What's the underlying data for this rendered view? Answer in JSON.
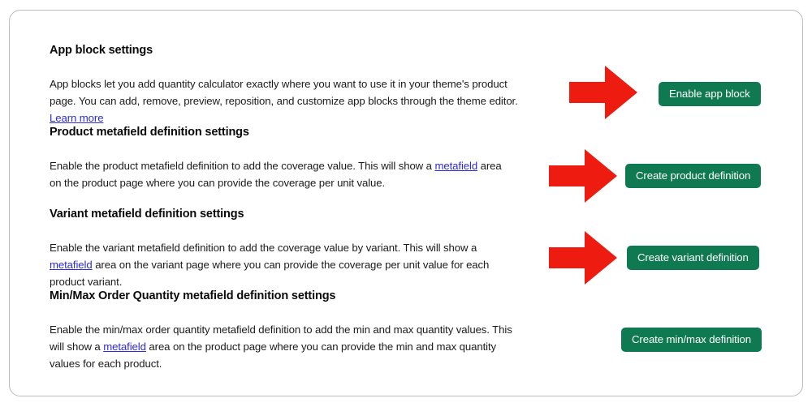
{
  "card": {
    "sections": [
      {
        "id": "app-block",
        "title": "App block settings",
        "body_pre": "App blocks let you add quantity calculator exactly where you want to use it in your theme's product page. You can add, remove, preview, reposition, and customize app blocks through the theme editor. ",
        "link_text": "Learn more",
        "body_post": "",
        "button_label": "Enable app block",
        "has_arrow": true,
        "arrow_name": "red-arrow-right-icon"
      },
      {
        "id": "product-metafield",
        "title": "Product metafield definition settings",
        "body_pre": "Enable the product metafield definition to add the coverage value. This will show a ",
        "link_text": "metafield",
        "body_post": " area on the product page where you can provide the coverage per unit value.",
        "button_label": "Create product definition",
        "has_arrow": true,
        "arrow_name": "red-arrow-right-icon"
      },
      {
        "id": "variant-metafield",
        "title": "Variant metafield definition settings",
        "body_pre": "Enable the variant metafield definition to add the coverage value by variant. This will show a ",
        "link_text": "metafield",
        "body_post": " area on the variant page where you can provide the coverage per unit value for each product variant.",
        "button_label": "Create variant definition",
        "has_arrow": true,
        "arrow_name": "red-arrow-right-icon"
      },
      {
        "id": "minmax-metafield",
        "title": "Min/Max Order Quantity metafield definition settings",
        "body_pre": "Enable the min/max order quantity metafield definition to add the min and max quantity values. This will show a ",
        "link_text": "metafield",
        "body_post": " area on the product page where you can provide the min and max quantity values for each product.",
        "button_label": "Create min/max definition",
        "has_arrow": false,
        "arrow_name": ""
      }
    ]
  },
  "colors": {
    "button_green": "#0f7a52",
    "arrow_red": "#ee1c10",
    "link_blue": "#2b2bdd",
    "card_border": "#b9bcc0",
    "text": "#1b1b1b",
    "background": "#ffffff"
  }
}
